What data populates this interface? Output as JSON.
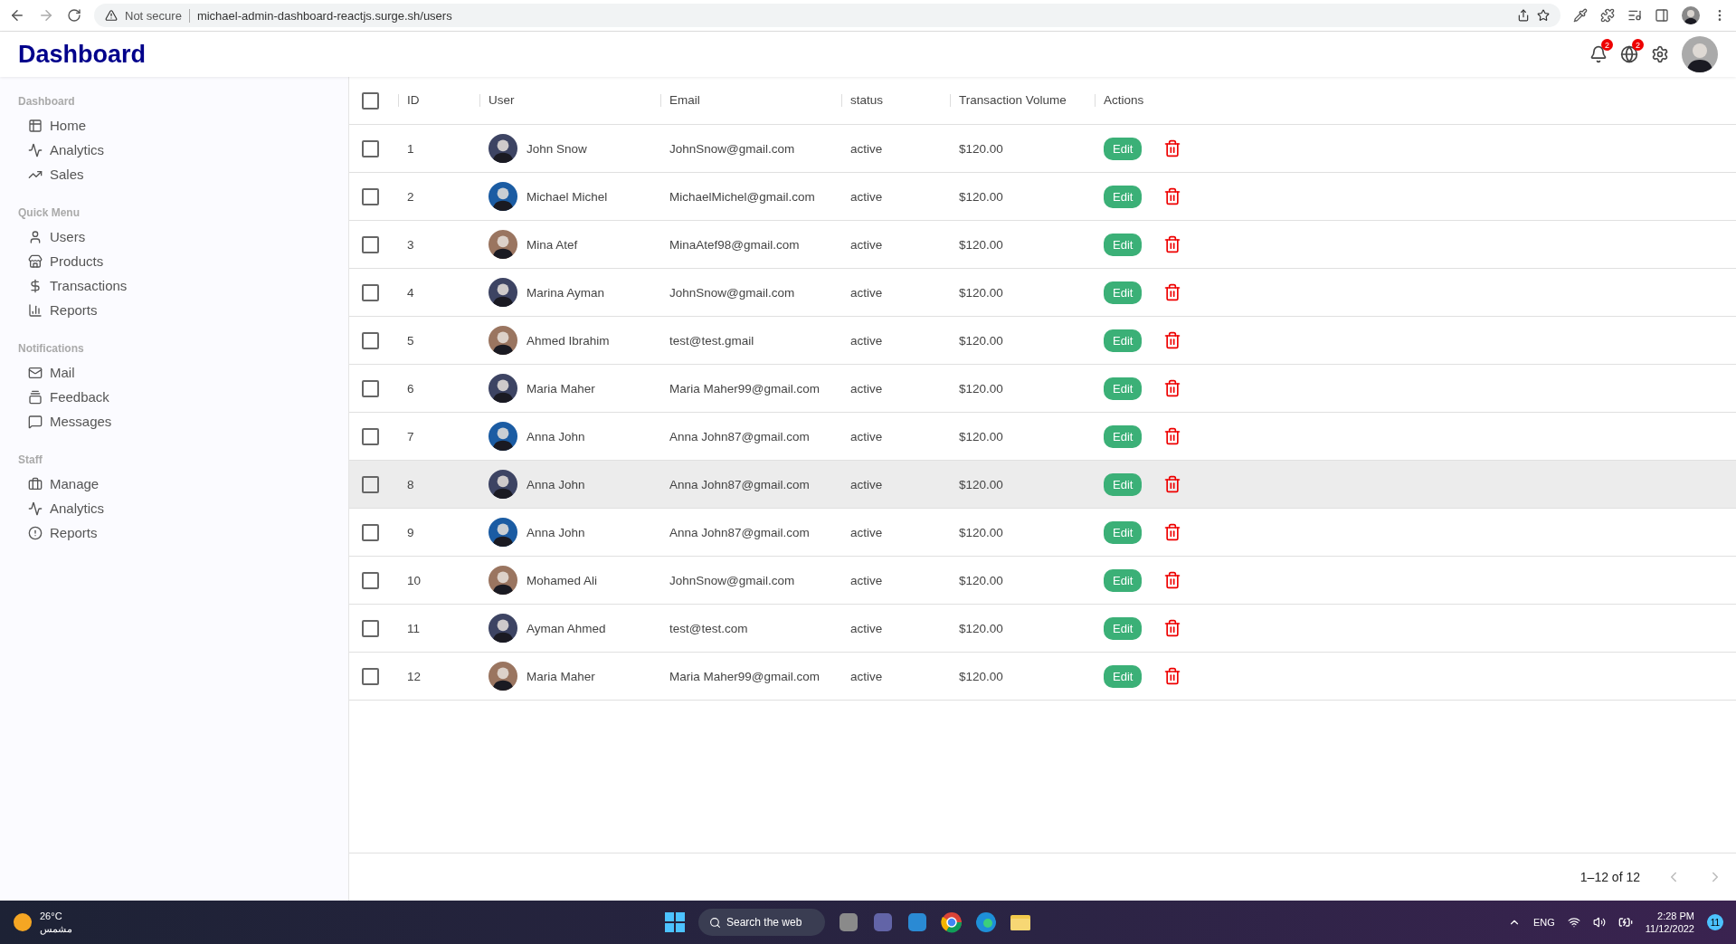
{
  "browser": {
    "security": "Not secure",
    "url": "michael-admin-dashboard-reactjs.surge.sh/users"
  },
  "header": {
    "title": "Dashboard",
    "notifications_badge": "2",
    "language_badge": "2"
  },
  "sidebar": [
    {
      "title": "Dashboard",
      "items": [
        {
          "label": "Home"
        },
        {
          "label": "Analytics"
        },
        {
          "label": "Sales"
        }
      ]
    },
    {
      "title": "Quick Menu",
      "items": [
        {
          "label": "Users"
        },
        {
          "label": "Products"
        },
        {
          "label": "Transactions"
        },
        {
          "label": "Reports"
        }
      ]
    },
    {
      "title": "Notifications",
      "items": [
        {
          "label": "Mail"
        },
        {
          "label": "Feedback"
        },
        {
          "label": "Messages"
        }
      ]
    },
    {
      "title": "Staff",
      "items": [
        {
          "label": "Manage"
        },
        {
          "label": "Analytics"
        },
        {
          "label": "Reports"
        }
      ]
    }
  ],
  "table": {
    "columns": [
      "ID",
      "User",
      "Email",
      "status",
      "Transaction Volume",
      "Actions"
    ],
    "all_checked": false,
    "rows": [
      {
        "id": "1",
        "user": "John Snow",
        "email": "JohnSnow@gmail.com",
        "status": "active",
        "volume": "$120.00",
        "edit": "Edit",
        "checked": false,
        "hovered": false
      },
      {
        "id": "2",
        "user": "Michael Michel",
        "email": "MichaelMichel@gmail.com",
        "status": "active",
        "volume": "$120.00",
        "edit": "Edit",
        "checked": false,
        "hovered": false
      },
      {
        "id": "3",
        "user": "Mina Atef",
        "email": "MinaAtef98@gmail.com",
        "status": "active",
        "volume": "$120.00",
        "edit": "Edit",
        "checked": false,
        "hovered": false
      },
      {
        "id": "4",
        "user": "Marina Ayman",
        "email": "JohnSnow@gmail.com",
        "status": "active",
        "volume": "$120.00",
        "edit": "Edit",
        "checked": false,
        "hovered": false
      },
      {
        "id": "5",
        "user": "Ahmed Ibrahim",
        "email": "test@test.gmail",
        "status": "active",
        "volume": "$120.00",
        "edit": "Edit",
        "checked": false,
        "hovered": false
      },
      {
        "id": "6",
        "user": "Maria Maher",
        "email": "Maria Maher99@gmail.com",
        "status": "active",
        "volume": "$120.00",
        "edit": "Edit",
        "checked": false,
        "hovered": false
      },
      {
        "id": "7",
        "user": "Anna John",
        "email": "Anna John87@gmail.com",
        "status": "active",
        "volume": "$120.00",
        "edit": "Edit",
        "checked": false,
        "hovered": false
      },
      {
        "id": "8",
        "user": "Anna John",
        "email": "Anna John87@gmail.com",
        "status": "active",
        "volume": "$120.00",
        "edit": "Edit",
        "checked": false,
        "hovered": true
      },
      {
        "id": "9",
        "user": "Anna John",
        "email": "Anna John87@gmail.com",
        "status": "active",
        "volume": "$120.00",
        "edit": "Edit",
        "checked": false,
        "hovered": false
      },
      {
        "id": "10",
        "user": "Mohamed Ali",
        "email": "JohnSnow@gmail.com",
        "status": "active",
        "volume": "$120.00",
        "edit": "Edit",
        "checked": false,
        "hovered": false
      },
      {
        "id": "11",
        "user": "Ayman Ahmed",
        "email": "test@test.com",
        "status": "active",
        "volume": "$120.00",
        "edit": "Edit",
        "checked": false,
        "hovered": false
      },
      {
        "id": "12",
        "user": "Maria Maher",
        "email": "Maria Maher99@gmail.com",
        "status": "active",
        "volume": "$120.00",
        "edit": "Edit",
        "checked": false,
        "hovered": false
      }
    ],
    "pagination": "1–12 of 12"
  },
  "taskbar": {
    "temperature": "26°C",
    "weather": "مشمس",
    "search": "Search the web",
    "language": "ENG",
    "time": "2:28 PM",
    "date": "11/12/2022",
    "notifications": "11"
  }
}
